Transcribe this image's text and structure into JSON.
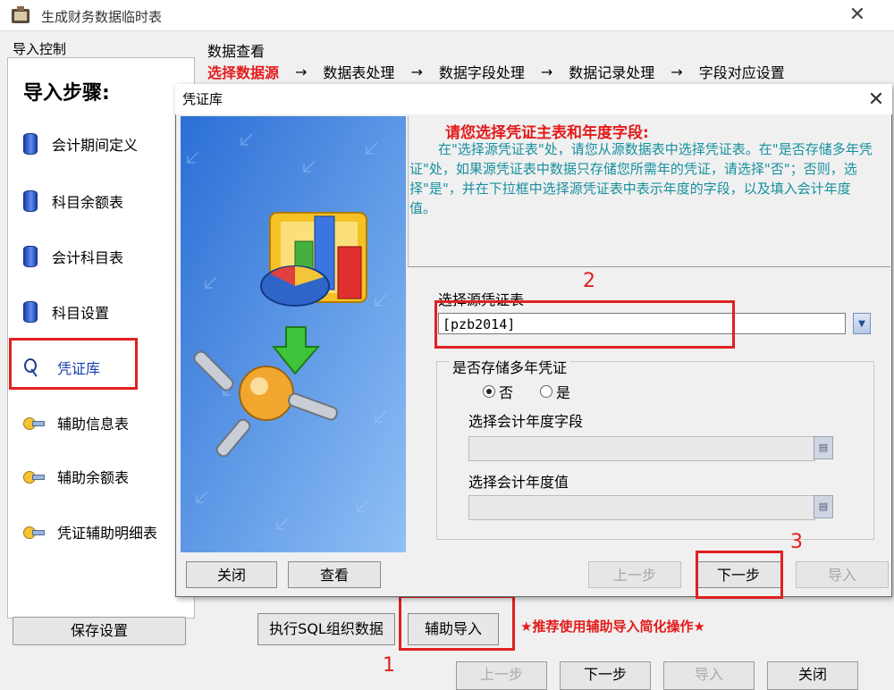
{
  "window": {
    "title": "生成财务数据临时表",
    "close": "✕"
  },
  "left_panel": {
    "header": "导入控制",
    "steps_title": "导入步骤:",
    "steps": [
      {
        "label": "会计期间定义",
        "icon": "database-icon"
      },
      {
        "label": "科目余额表",
        "icon": "database-icon"
      },
      {
        "label": "会计科目表",
        "icon": "database-icon"
      },
      {
        "label": "科目设置",
        "icon": "database-icon"
      },
      {
        "label": "凭证库",
        "icon": "magnifier-icon"
      },
      {
        "label": "辅助信息表",
        "icon": "key-icon"
      },
      {
        "label": "辅助余额表",
        "icon": "key-icon"
      },
      {
        "label": "凭证辅助明细表",
        "icon": "key-icon"
      }
    ],
    "save_button": "保存设置"
  },
  "data_view": {
    "label": "数据查看",
    "breadcrumb": [
      "选择数据源",
      "→",
      "数据表处理",
      "→",
      "数据字段处理",
      "→",
      "数据记录处理",
      "→",
      "字段对应设置"
    ]
  },
  "bottom": {
    "exec_sql_button": "执行SQL组织数据",
    "aux_import_button": "辅助导入",
    "recommend_note": "★推荐使用辅助导入简化操作★",
    "marker_1": "1",
    "ghost_buttons": [
      "上一步",
      "下一步",
      "导入",
      "关闭"
    ]
  },
  "dialog": {
    "title": "凭证库",
    "close": "✕",
    "instruction_heading": "请您选择凭证主表和年度字段:",
    "instruction_body": "在\"选择源凭证表\"处，请您从源数据表中选择凭证表。在\"是否存储多年凭证\"处，如果源凭证表中数据只存储您所需年的凭证，请选择\"否\"；否则，选择\"是\"，并在下拉框中选择源凭证表中表示年度的字段，以及填入会计年度值。",
    "source_table_label": "选择源凭证表",
    "source_table_value": "[pzb2014]",
    "marker_2": "2",
    "multi_year_label": "是否存储多年凭证",
    "radio_no": "否",
    "radio_yes": "是",
    "radio_selected": "否",
    "year_field_label": "选择会计年度字段",
    "year_value_label": "选择会计年度值",
    "buttons": {
      "close": "关闭",
      "view": "查看",
      "prev": "上一步",
      "next": "下一步",
      "import": "导入"
    },
    "marker_3": "3"
  },
  "colors": {
    "annotation_red": "#e02020",
    "instruction_teal": "#17909e",
    "heading_red": "#e41b1b"
  }
}
